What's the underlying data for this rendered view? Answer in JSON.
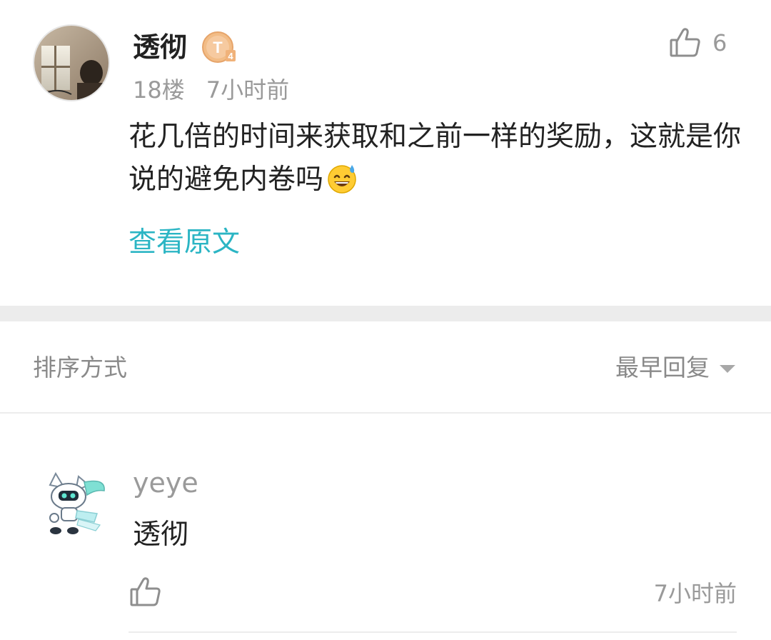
{
  "main_comment": {
    "username": "透彻",
    "level_badge": "T4",
    "floor": "18楼",
    "time": "7小时前",
    "like_count": "6",
    "text": "花几倍的时间来获取和之前一样的奖励，这就是你说的避免内卷吗",
    "emoji": "sweat-smile-emoji",
    "view_original_label": "查看原文",
    "icons": {
      "like": "thumbs-up-icon"
    }
  },
  "sort_bar": {
    "label": "排序方式",
    "selected": "最早回复",
    "icon": "caret-down-icon"
  },
  "reply": {
    "username": "yeye",
    "text": "透彻",
    "time": "7小时前",
    "icons": {
      "like": "thumbs-up-icon"
    }
  },
  "colors": {
    "link": "#2bb5c4",
    "text_primary": "#222222",
    "text_secondary": "#9a9a9a",
    "band": "#ececec",
    "badge": "#f0b27a"
  }
}
